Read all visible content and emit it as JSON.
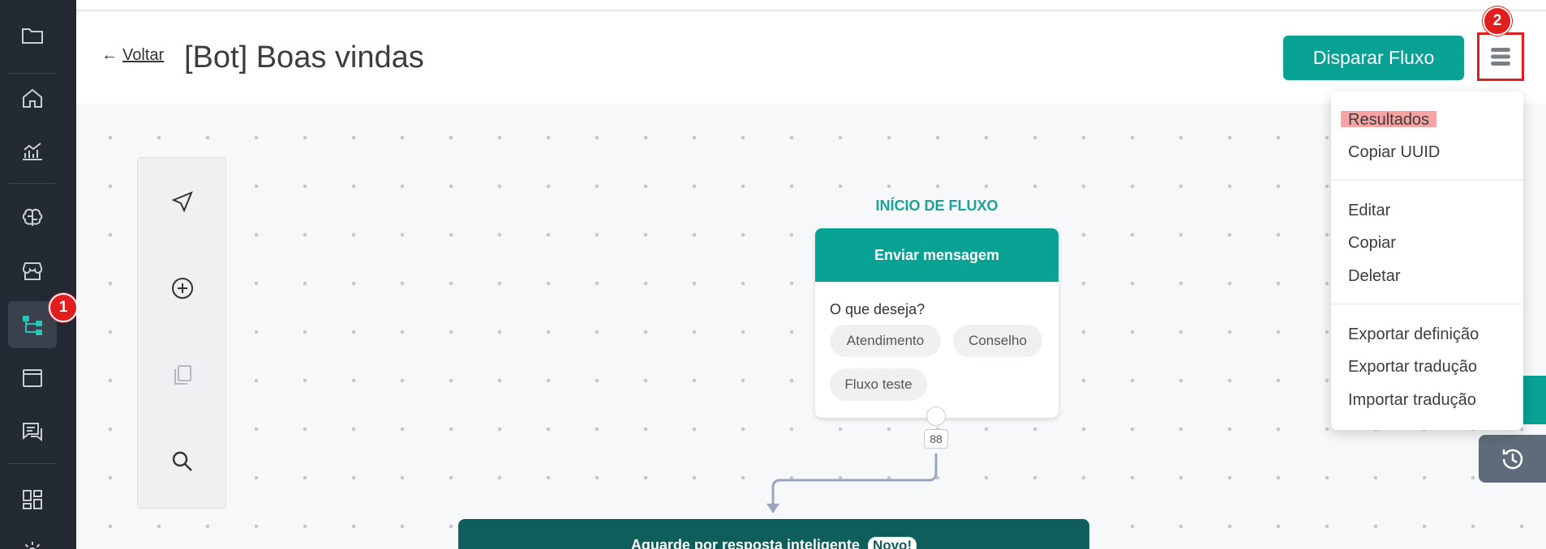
{
  "header": {
    "back_arrow": "←",
    "back_label": "Voltar",
    "title": "[Bot] Boas vindas",
    "primary_button": "Disparar Fluxo"
  },
  "annotations": [
    "1",
    "2"
  ],
  "sidebar": {
    "items": [
      {
        "icon": "folder-icon"
      },
      {
        "icon": "home-icon"
      },
      {
        "icon": "analytics-icon"
      },
      {
        "icon": "brain-icon"
      },
      {
        "icon": "store-icon"
      },
      {
        "icon": "flows-icon",
        "active": true
      },
      {
        "icon": "window-icon"
      },
      {
        "icon": "chat-icon"
      },
      {
        "icon": "dashboard-icon"
      },
      {
        "icon": "settings-icon"
      }
    ]
  },
  "toolbar": {
    "tools": [
      "send-icon",
      "add-circle-icon",
      "copy-icon",
      "search-icon"
    ]
  },
  "flow": {
    "start_label": "INÍCIO DE FLUXO",
    "node": {
      "header": "Enviar mensagem",
      "question": "O que deseja?",
      "chips": [
        "Atendimento",
        "Conselho",
        "Fluxo teste"
      ],
      "count": "88"
    },
    "next_node": {
      "header": "Aguarde por resposta inteligente",
      "badge": "Novo!"
    }
  },
  "dropdown": {
    "group1": [
      "Resultados",
      "Copiar UUID"
    ],
    "group2": [
      "Editar",
      "Copiar",
      "Deletar"
    ],
    "group3": [
      "Exportar definição",
      "Exportar tradução",
      "Importar tradução"
    ]
  },
  "colors": {
    "accent": "#0aa195",
    "sidebar": "#242a33",
    "annotation": "#e11d1d"
  }
}
